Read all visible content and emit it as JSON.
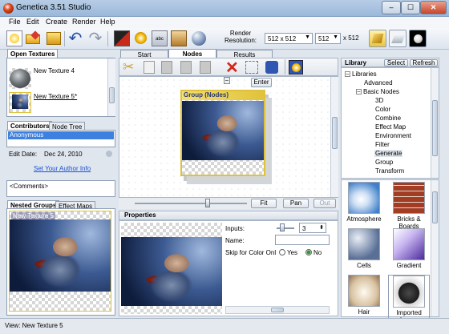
{
  "window": {
    "title": "Genetica 3.51 Studio",
    "minimize": "–",
    "maximize": "☐",
    "close": "✕"
  },
  "menu": [
    "File",
    "Edit",
    "Create",
    "Render",
    "Help"
  ],
  "toolbar": {
    "render_label_line1": "Render",
    "render_label_line2": "Resolution:",
    "resolution": "512 x 512",
    "width": "512",
    "height_label": "x 512"
  },
  "left": {
    "open_textures_tab": "Open Textures",
    "textures": [
      {
        "name": "New Texture 4"
      },
      {
        "name": "New Texture 5*"
      }
    ],
    "tabs2": [
      "Contributors",
      "Node Tree"
    ],
    "contributor": "Anonymous",
    "edit_date_label": "Edit Date:",
    "edit_date": "Dec 24, 2010",
    "author_link": "Set Your Author Info",
    "comments": "<Comments>",
    "tabs3": [
      "Nested Groups",
      "Effect Maps"
    ],
    "nested_label": "New Texture 5"
  },
  "center": {
    "tabs": [
      "Start",
      "Nodes",
      "Results"
    ],
    "node_title": "Group (Nodes)",
    "enter_button": "Enter",
    "fit": "Fit",
    "pan": "Pan",
    "out": "Out",
    "properties_header": "Properties",
    "inputs_label": "Inputs:",
    "inputs_value": "3",
    "name_label": "Name:",
    "skip_label": "Skip for Color Onl",
    "yes": "Yes",
    "no": "No"
  },
  "library": {
    "header": "Library",
    "select_button": "Select",
    "refresh_button": "Refresh",
    "tree": [
      {
        "label": "Libraries",
        "level": 0,
        "box": "–"
      },
      {
        "label": "Advanced",
        "level": 1
      },
      {
        "label": "Basic Nodes",
        "level": 1,
        "box": "–"
      },
      {
        "label": "3D",
        "level": 2
      },
      {
        "label": "Color",
        "level": 2
      },
      {
        "label": "Combine",
        "level": 2
      },
      {
        "label": "Effect Map",
        "level": 2
      },
      {
        "label": "Environment",
        "level": 2
      },
      {
        "label": "Filter",
        "level": 2
      },
      {
        "label": "Generate",
        "level": 2
      },
      {
        "label": "Group",
        "level": 2
      },
      {
        "label": "Transform",
        "level": 2
      }
    ],
    "items": [
      "Atmosphere",
      "Bricks & Boards",
      "Cells",
      "Gradient",
      "Hair",
      "Imported Image"
    ]
  },
  "status": "View: New Texture 5",
  "colors": {
    "accent": "#3b6fb6",
    "node_border": "#e0c23a",
    "selection": "#3d80df"
  }
}
